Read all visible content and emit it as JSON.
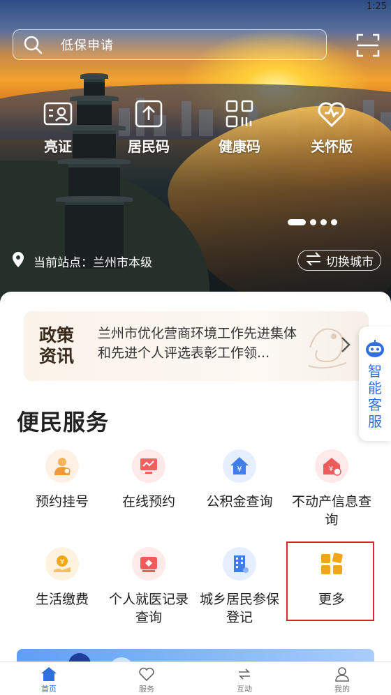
{
  "status_bar": {
    "time": "1:25"
  },
  "search": {
    "placeholder": "低保申请"
  },
  "quick_actions": [
    {
      "label": "亮证",
      "icon": "id-card-icon"
    },
    {
      "label": "居民码",
      "icon": "upload-code-icon"
    },
    {
      "label": "健康码",
      "icon": "qr-code-icon"
    },
    {
      "label": "关怀版",
      "icon": "heart-icon"
    }
  ],
  "carousel": {
    "count": 4,
    "active": 1
  },
  "location": {
    "text": "当前站点：兰州市本级",
    "switch_label": "切换城市"
  },
  "news": {
    "tag_line1": "政策",
    "tag_line2": "资讯",
    "headline": "兰州市优化营商环境工作先进集体和先进个人评选表彰工作领..."
  },
  "assistant": {
    "label_chars": [
      "智",
      "能",
      "客",
      "服"
    ]
  },
  "services": {
    "title": "便民服务",
    "items": [
      {
        "label": "预约挂号",
        "icon": "doctor-icon"
      },
      {
        "label": "在线预约",
        "icon": "monitor-chart-icon"
      },
      {
        "label": "公积金查询",
        "icon": "house-yen-icon"
      },
      {
        "label": "不动产信息查询",
        "icon": "property-icon"
      },
      {
        "label": "生活缴费",
        "icon": "hand-coin-icon"
      },
      {
        "label": "个人就医记录查询",
        "icon": "medical-record-icon"
      },
      {
        "label": "城乡居民参保登记",
        "icon": "building-icon"
      },
      {
        "label": "更多",
        "icon": "grid-more-icon"
      }
    ]
  },
  "tabbar": [
    {
      "label": "首页",
      "icon": "home-icon",
      "active": true
    },
    {
      "label": "服务",
      "icon": "heart-outline-icon",
      "active": false
    },
    {
      "label": "互动",
      "icon": "exchange-icon",
      "active": false
    },
    {
      "label": "我的",
      "icon": "user-icon",
      "active": false
    }
  ],
  "colors": {
    "accent": "#2f6fe0",
    "highlight": "#d8262d",
    "more_orange": "#f2a71b"
  }
}
